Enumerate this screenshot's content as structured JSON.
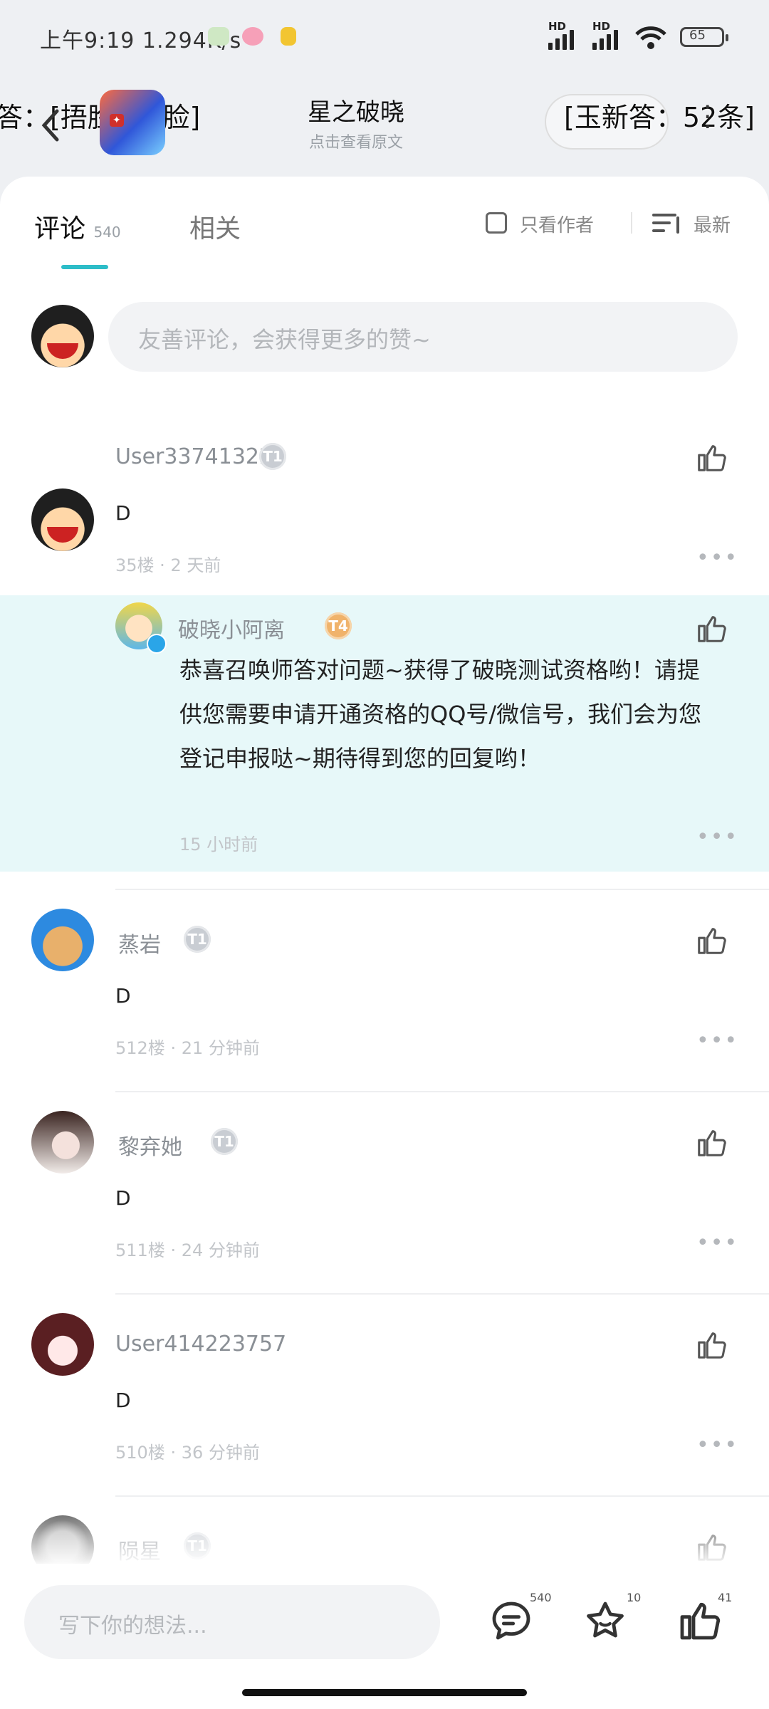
{
  "status_bar": {
    "time": "上午9:19",
    "net_speed": "1.294K/s",
    "hd_1": "HD",
    "hd_2": "HD",
    "battery": "65"
  },
  "danmaku": {
    "left": "答：[捂脸][捂脸]",
    "right": "[玉新答：52条]"
  },
  "header": {
    "title": "星之破晓",
    "subtitle": "点击查看原文"
  },
  "tabs": {
    "comments_label": "评论",
    "comments_count": "540",
    "related_label": "相关",
    "author_only_label": "只看作者",
    "sort_label": "最新"
  },
  "compose": {
    "placeholder": "友善评论，会获得更多的赞~"
  },
  "comments": [
    {
      "user": "User33741322",
      "level": "T1",
      "text": "D",
      "floor": "35楼",
      "time": "2 天前"
    },
    {
      "user": "蒸岩",
      "level": "T1",
      "text": "D",
      "floor": "512楼",
      "time": "21 分钟前"
    },
    {
      "user": "黎弃她",
      "level": "T1",
      "text": "D",
      "floor": "511楼",
      "time": "24 分钟前"
    },
    {
      "user": "User414223757",
      "level": "",
      "text": "D",
      "floor": "510楼",
      "time": "36 分钟前"
    },
    {
      "user": "陨星",
      "level": "T1"
    }
  ],
  "reply": {
    "user": "破晓小阿离",
    "level": "T4",
    "text": "恭喜召唤师答对问题~获得了破晓测试资格哟！请提供您需要申请开通资格的QQ号/微信号，我们会为您登记申报哒~期待得到您的回复哟！",
    "time": "15 小时前"
  },
  "bottom_bar": {
    "placeholder": "写下你的想法...",
    "comment_count": "540",
    "star_count": "10",
    "like_count": "41"
  },
  "colors": {
    "accent": "#2dbdc8",
    "reply_bg": "#e7f8f9"
  }
}
